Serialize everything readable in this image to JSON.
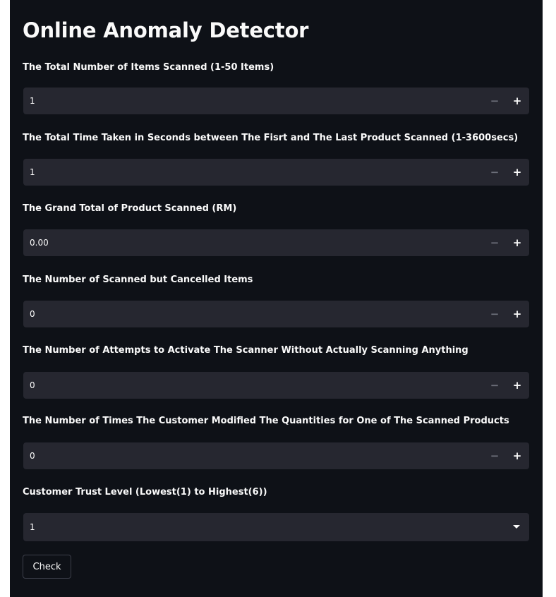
{
  "app": {
    "title": "Online Anomaly Detector"
  },
  "fields": [
    {
      "label": "The Total Number of Items Scanned (1-50 Items)",
      "value": "1",
      "minus": "−",
      "plus": "+"
    },
    {
      "label": "The Total Time Taken in Seconds between The Fisrt and The Last Product Scanned (1-3600secs)",
      "value": "1",
      "minus": "−",
      "plus": "+"
    },
    {
      "label": "The Grand Total of Product Scanned (RM)",
      "value": "0.00",
      "minus": "−",
      "plus": "+"
    },
    {
      "label": "The Number of Scanned but Cancelled Items",
      "value": "0",
      "minus": "−",
      "plus": "+"
    },
    {
      "label": "The Number of Attempts to Activate The Scanner Without Actually Scanning Anything",
      "value": "0",
      "minus": "−",
      "plus": "+"
    },
    {
      "label": "The Number of Times The Customer Modified The Quantities for One of The Scanned Products",
      "value": "0",
      "minus": "−",
      "plus": "+"
    }
  ],
  "trust": {
    "label": "Customer Trust Level (Lowest(1) to Highest(6))",
    "selected": "1",
    "icon": "chevron-down-icon"
  },
  "check_button": {
    "label": "Check"
  },
  "colors": {
    "background": "#0e1117",
    "input_background": "#262730",
    "text": "#fafafa",
    "muted": "#6c6f7a"
  }
}
